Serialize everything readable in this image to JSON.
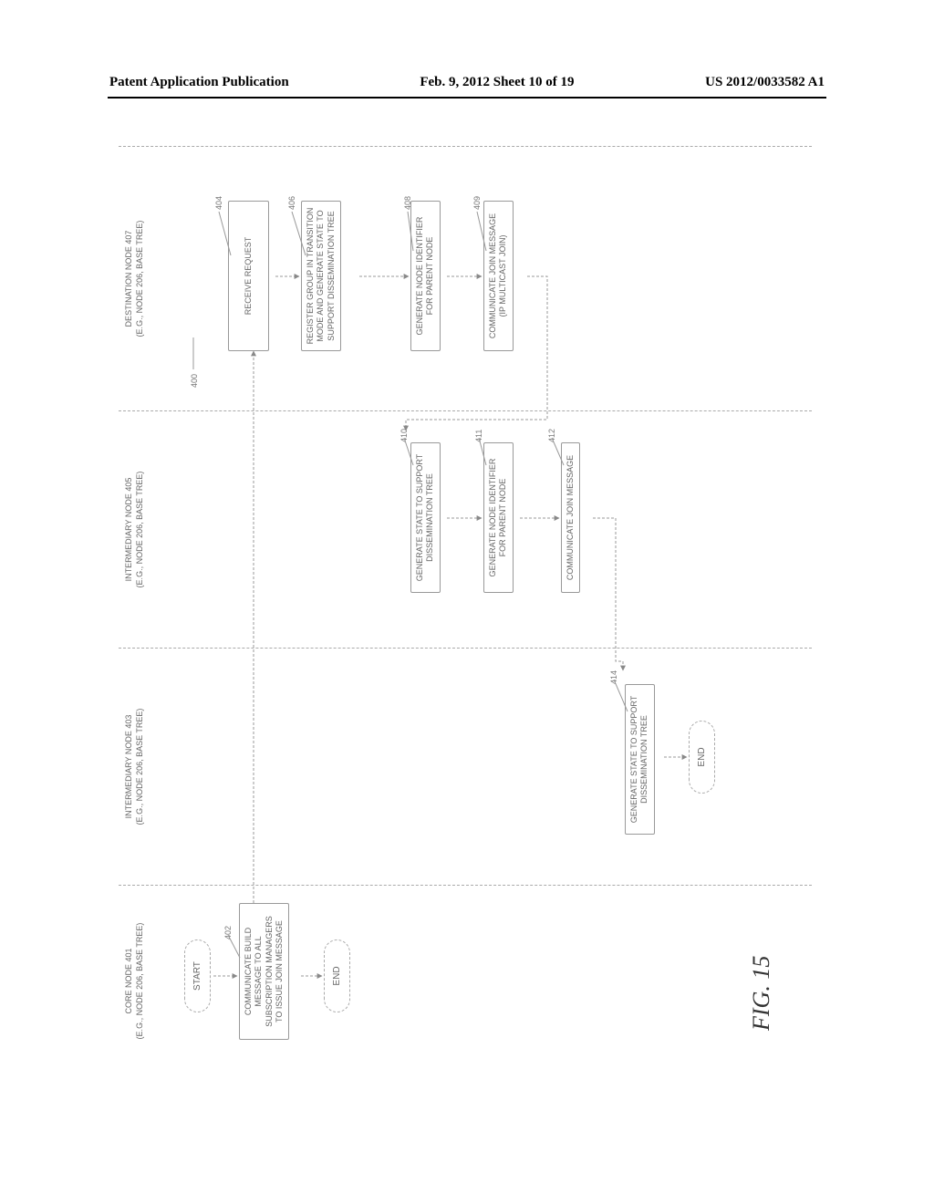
{
  "header": {
    "left": "Patent Application Publication",
    "center": "Feb. 9, 2012  Sheet 10 of 19",
    "right": "US 2012/0033582 A1"
  },
  "figure_label": "FIG. 15",
  "diagram_number": "400",
  "lanes": {
    "core": {
      "title": "CORE NODE 401\n(E.G., NODE 206, BASE TREE)"
    },
    "inter1": {
      "title": "INTERMEDIARY NODE 403\n(E.G., NODE 206, BASE TREE)"
    },
    "inter2": {
      "title": "INTERMEDIARY NODE 405\n(E.G., NODE 206, BASE TREE)"
    },
    "dest": {
      "title": "DESTINATION NODE 407\n(E.G., NODE 206, BASE TREE)"
    }
  },
  "terminators": {
    "start": "START",
    "end1": "END",
    "end2": "END"
  },
  "steps": {
    "s402": {
      "num": "402",
      "text": "COMMUNICATE BUILD MESSAGE TO ALL SUBSCRIPTION MANAGERS TO ISSUE JOIN MESSAGE"
    },
    "s404": {
      "num": "404",
      "text": "RECEIVE REQUEST"
    },
    "s406": {
      "num": "406",
      "text": "REGISTER GROUP IN TRANSITION MODE AND GENERATE STATE TO SUPPORT DISSEMINATION TREE"
    },
    "s408": {
      "num": "408",
      "text": "GENERATE NODE IDENTIFIER FOR PARENT NODE"
    },
    "s409": {
      "num": "409",
      "text": "COMMUNICATE JOIN MESSAGE\n(IP MULTICAST JOIN)"
    },
    "s410": {
      "num": "410",
      "text": "GENERATE STATE TO SUPPORT DISSEMINATION TREE"
    },
    "s411": {
      "num": "411",
      "text": "GENERATE NODE IDENTIFIER FOR PARENT NODE"
    },
    "s412": {
      "num": "412",
      "text": "COMMUNICATE JOIN MESSAGE"
    },
    "s414": {
      "num": "414",
      "text": "GENERATE STATE TO SUPPORT DISSEMINATION TREE"
    }
  }
}
